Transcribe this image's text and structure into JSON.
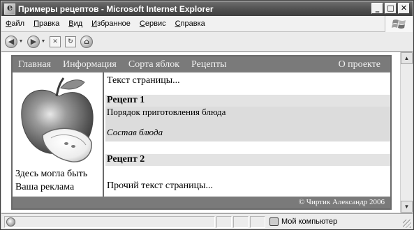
{
  "window": {
    "title": "Примеры рецептов - Microsoft Internet Explorer",
    "controls": [
      "_",
      "□",
      "✕"
    ]
  },
  "menu": {
    "items": [
      {
        "accel": "Ф",
        "rest": "айл"
      },
      {
        "accel": "П",
        "rest": "равка"
      },
      {
        "accel": "В",
        "rest": "ид"
      },
      {
        "accel": "И",
        "rest": "збранное"
      },
      {
        "accel": "С",
        "rest": "ервис"
      },
      {
        "accel": "С",
        "rest": "правка"
      }
    ]
  },
  "toolbar": {
    "icons": [
      "back-icon",
      "forward-icon",
      "stop-icon",
      "refresh-icon",
      "home-icon"
    ]
  },
  "page": {
    "nav": {
      "links": [
        "Главная",
        "Информация",
        "Сорта яблок",
        "Рецепты"
      ],
      "right_link": "О проекте"
    },
    "sidebar": {
      "ad_line1": "Здесь могла быть",
      "ad_line2": "Ваша реклама"
    },
    "main": {
      "intro": "Текст страницы...",
      "recipe1_heading": "Рецепт 1",
      "recipe1_text": "Порядок приготовления блюда",
      "recipe1_ingredients": "Состав блюда",
      "recipe2_heading": "Рецепт 2",
      "outro": "Прочий текст страницы..."
    },
    "footer": "© Чиртик Александр 2006"
  },
  "status": {
    "zone_label": "Мой компьютер"
  }
}
